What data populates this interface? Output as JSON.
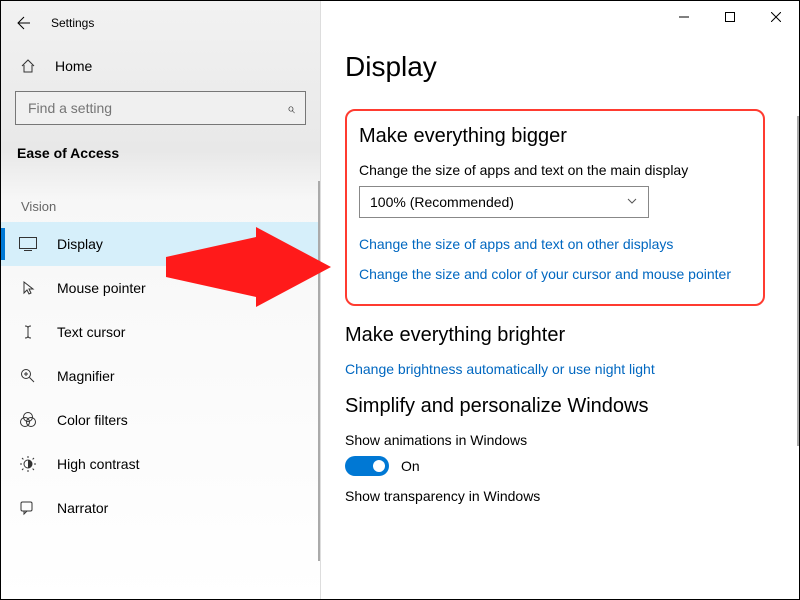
{
  "window": {
    "title": "Settings"
  },
  "sidebar": {
    "home_label": "Home",
    "search_placeholder": "Find a setting",
    "category": "Ease of Access",
    "group_label": "Vision",
    "items": [
      {
        "label": "Display",
        "icon": "display-icon",
        "active": true
      },
      {
        "label": "Mouse pointer",
        "icon": "mouse-pointer-icon"
      },
      {
        "label": "Text cursor",
        "icon": "text-cursor-icon"
      },
      {
        "label": "Magnifier",
        "icon": "magnifier-icon"
      },
      {
        "label": "Color filters",
        "icon": "color-filters-icon"
      },
      {
        "label": "High contrast",
        "icon": "high-contrast-icon"
      },
      {
        "label": "Narrator",
        "icon": "narrator-icon"
      }
    ]
  },
  "page": {
    "title": "Display",
    "bigger": {
      "heading": "Make everything bigger",
      "sub_label": "Change the size of apps and text on the main display",
      "dropdown_value": "100% (Recommended)",
      "link1": "Change the size of apps and text on other displays",
      "link2": "Change the size and color of your cursor and mouse pointer"
    },
    "brighter": {
      "heading": "Make everything brighter",
      "link1": "Change brightness automatically or use night light"
    },
    "simplify": {
      "heading": "Simplify and personalize Windows",
      "animations_label": "Show animations in Windows",
      "animations_state": "On",
      "transparency_label": "Show transparency in Windows"
    }
  },
  "annotations": {
    "arrow_color": "#ff1a1a"
  }
}
